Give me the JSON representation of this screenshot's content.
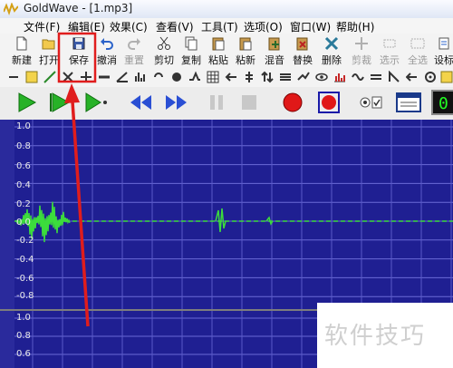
{
  "window": {
    "title": "GoldWave - [1.mp3]"
  },
  "menu": [
    "文件(F)",
    "编辑(E)",
    "效果(C)",
    "查看(V)",
    "工具(T)",
    "选项(O)",
    "窗口(W)",
    "帮助(H)"
  ],
  "toolbar": {
    "new": "新建",
    "open": "打开",
    "save": "保存",
    "undo": "撤消",
    "redo": "重置",
    "cut": "剪切",
    "copy": "复制",
    "paste": "粘贴",
    "paste_new": "粘新",
    "mix": "混音",
    "replace": "替换",
    "delete": "删除",
    "trim": "剪裁",
    "select_view": "选示",
    "select_all": "全选",
    "set": "设标"
  },
  "counter": {
    "value": "0"
  },
  "waveform": {
    "upper_ticks": [
      "1.0",
      "0.8",
      "0.6",
      "0.4",
      "0.2",
      "0.0",
      "-0.2",
      "-0.4",
      "-0.6",
      "-0.8"
    ],
    "lower_ticks": [
      "1.0",
      "0.8",
      "0.6"
    ],
    "wave_color": "#3cdc3c",
    "background_color": "#1f1f92"
  },
  "annotation": {
    "highlight_color": "#e01d1d"
  },
  "watermark": "软件技巧"
}
